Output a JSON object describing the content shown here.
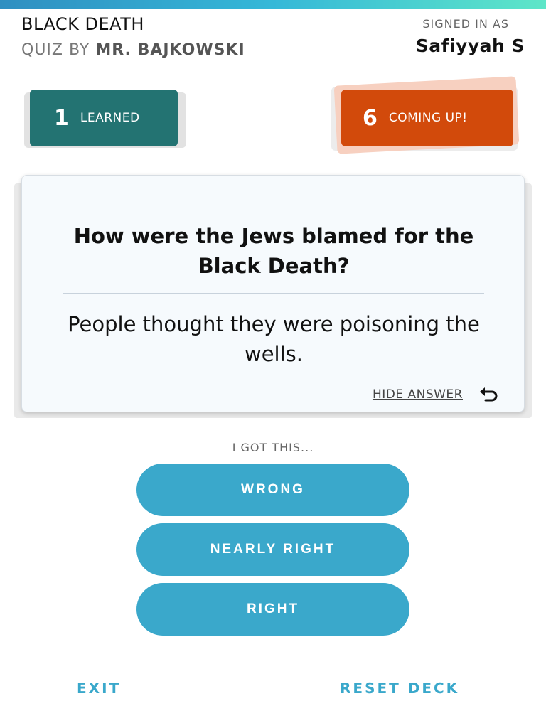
{
  "header": {
    "deck_title": "BLACK DEATH",
    "quiz_by_prefix": "QUIZ BY",
    "quiz_author": "MR. BAJKOWSKI",
    "signed_in_label": "SIGNED IN AS",
    "signed_in_user": "Safiyyah S"
  },
  "counters": {
    "learned": {
      "count": "1",
      "label": "LEARNED",
      "color": "#237372"
    },
    "coming_up": {
      "count": "6",
      "label": "COMING UP!",
      "color": "#d24a0b"
    }
  },
  "flashcard": {
    "question": "How were the Jews blamed for the Black Death?",
    "answer": "People thought they were poisoning the wells.",
    "hide_answer_label": "HIDE ANSWER",
    "hide_answer_icon": "undo-arrow-icon"
  },
  "rating": {
    "prompt": "I GOT THIS...",
    "options": [
      {
        "label": "WRONG"
      },
      {
        "label": "NEARLY RIGHT"
      },
      {
        "label": "RIGHT"
      }
    ],
    "button_color": "#3aa8cb"
  },
  "footer": {
    "exit_label": "EXIT",
    "reset_label": "RESET DECK"
  }
}
